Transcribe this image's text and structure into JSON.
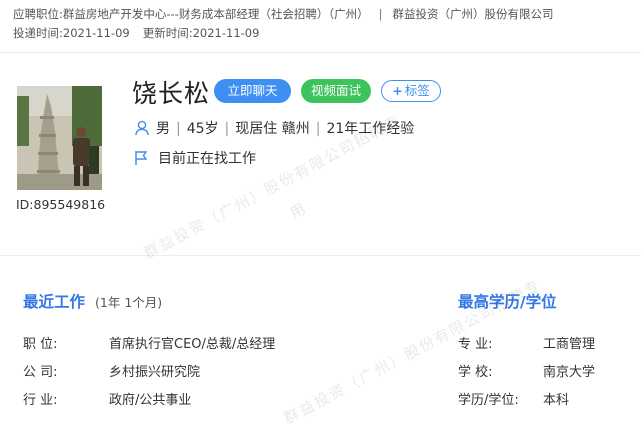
{
  "header": {
    "position_label": "应聘职位:",
    "position_value": "群益房地产开发中心---财务成本部经理（社会招聘）（广州）",
    "company": "群益投资（广州）股份有限公司",
    "submit_label": "投递时间:",
    "submit_date": "2021-11-09",
    "update_label": "更新时间:",
    "update_date": "2021-11-09"
  },
  "candidate": {
    "name": "饶长松",
    "id": "ID:895549816",
    "gender": "男",
    "age": "45岁",
    "residence": "现居住 赣州",
    "experience": "21年工作经验",
    "job_status": "目前正在找工作"
  },
  "actions": {
    "chat": "立即聊天",
    "video": "视频面试",
    "tag": "标签"
  },
  "recent_work": {
    "title": "最近工作",
    "duration": "(1年 1个月)",
    "rows": [
      {
        "label": "职    位:",
        "value": "首席执行官CEO/总裁/总经理"
      },
      {
        "label": "公    司:",
        "value": "乡村振兴研究院"
      },
      {
        "label": "行    业:",
        "value": "政府/公共事业"
      }
    ]
  },
  "education": {
    "title": "最高学历/学位",
    "rows": [
      {
        "label": "专    业:",
        "value": "工商管理"
      },
      {
        "label": "学    校:",
        "value": "南京大学"
      },
      {
        "label": "学历/学位:",
        "value": "本科"
      }
    ]
  },
  "watermark": {
    "line1": "群益投资（广州）股份有限公司招聘专",
    "line2": "用"
  },
  "colors": {
    "accent": "#3f8ff3",
    "green": "#3cc35c",
    "section_title": "#3478e6"
  },
  "icons": [
    "person-icon",
    "flag-icon",
    "plus-icon"
  ]
}
